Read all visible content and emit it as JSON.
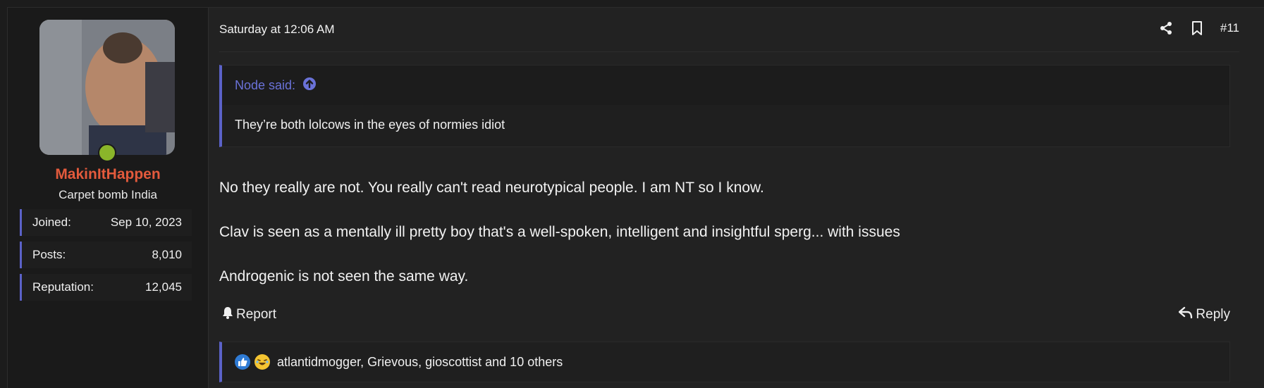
{
  "user": {
    "username": "MakinItHappen",
    "title": "Carpet bomb India",
    "avatar_alt": "avatar",
    "stats": [
      {
        "label": "Joined:",
        "value": "Sep 10, 2023"
      },
      {
        "label": "Posts:",
        "value": "8,010"
      },
      {
        "label": "Reputation:",
        "value": "12,045"
      }
    ],
    "online": true
  },
  "post": {
    "date": "Saturday at 12:06 AM",
    "number": "#11",
    "quote": {
      "author": "Node said:",
      "text": "They’re both lolcows in the eyes of normies idiot"
    },
    "paragraphs": [
      "No they really are not. You really can't read neurotypical people. I am NT so I know.",
      "Clav is seen as a mentally ill pretty boy that's a well-spoken, intelligent and insightful sperg... with issues",
      "Androgenic is not seen the same way."
    ],
    "report_label": "Report",
    "reply_label": "Reply",
    "reactions_text": "atlantidmogger, Grievous, gioscottist and 10 others"
  },
  "icons": {
    "share": "share-icon",
    "bookmark": "bookmark-icon",
    "quote_jump": "arrow-up-circle-icon",
    "report": "bell-icon",
    "reply": "reply-icon",
    "like": "thumbs-up-icon",
    "laugh": "laugh-emoji-icon"
  },
  "colors": {
    "accent": "#5b62c8",
    "username": "#e35a3c",
    "quote_author": "#6a72d8",
    "online": "#8ab52a"
  }
}
